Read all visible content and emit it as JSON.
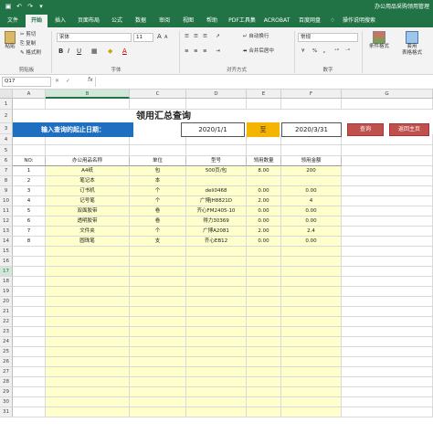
{
  "title": {
    "doc": "办公用品采购领用管理"
  },
  "qat": {
    "save_icon": "save-icon",
    "undo_icon": "undo-icon",
    "redo_icon": "redo-icon",
    "customize_icon": "customize-icon"
  },
  "tabs": [
    "文件",
    "开始",
    "插入",
    "页面布局",
    "公式",
    "数据",
    "审阅",
    "视图",
    "帮助",
    "PDF工具集",
    "ACROBAT",
    "百度网盘",
    "操作说明搜索"
  ],
  "active_tab": "开始",
  "ribbon": {
    "paste": "粘贴",
    "cut": "剪切",
    "copy": "复制",
    "format_painter": "格式刷",
    "clipboard": "剪贴板",
    "font_name": "宋体",
    "font_size": "11",
    "font_group": "字体",
    "wrap_text": "自动换行",
    "merge_center": "合并后居中",
    "align_group": "对齐方式",
    "number_format": "常规",
    "number_group": "数字",
    "cond_format": "条件格式",
    "table_format": "套用\n表格格式",
    "bold": "B",
    "italic": "I",
    "underline": "U",
    "font_grow": "A",
    "font_shrink": "A",
    "font_color": "A",
    "percent": "%",
    "comma": ","
  },
  "formula_bar": {
    "name_box": "Q17",
    "fx": "fx",
    "value": ""
  },
  "columns": [
    "A",
    "B",
    "C",
    "D",
    "E",
    "F",
    "G"
  ],
  "rows": [
    "1",
    "2",
    "3",
    "4",
    "5",
    "6",
    "7",
    "8",
    "9",
    "10",
    "11",
    "12",
    "13",
    "14",
    "15",
    "16",
    "17",
    "18",
    "19",
    "20",
    "21",
    "22",
    "23",
    "24",
    "25",
    "26",
    "27",
    "28",
    "29",
    "30",
    "31"
  ],
  "sheet": {
    "title": "领用汇总查询",
    "query_label": "输入查询的起止日期：",
    "start_date": "2020/1/1",
    "to_label": "至",
    "end_date": "2020/3/31",
    "query_button": "查询",
    "home_button": "返回主页"
  },
  "table": {
    "headers": [
      "NO:",
      "办公用品名称",
      "单位",
      "型号",
      "领用数量",
      "领用金额"
    ],
    "rows": [
      [
        "1",
        "A4纸",
        "包",
        "500页/包",
        "8.00",
        "200"
      ],
      [
        "2",
        "笔记本",
        "本",
        "",
        "",
        ""
      ],
      [
        "3",
        "订书机",
        "个",
        "deli0468",
        "0.00",
        "0.00"
      ],
      [
        "4",
        "记号笔",
        "个",
        "广博JH8821D",
        "2.00",
        "4"
      ],
      [
        "5",
        "双面胶带",
        "卷",
        "齐心FM2405-10",
        "0.00",
        "0.00"
      ],
      [
        "6",
        "透明胶带",
        "卷",
        "得力30369",
        "0.00",
        "0.00"
      ],
      [
        "7",
        "文件夹",
        "个",
        "广博A2081",
        "2.00",
        "2.4"
      ],
      [
        "8",
        "圆珠笔",
        "支",
        "齐心EB12",
        "0.00",
        "0.00"
      ]
    ]
  },
  "colors": {
    "excel_green": "#217346",
    "query_blue": "#1f6fc0",
    "to_orange": "#f4b400",
    "button_red": "#c0504d",
    "cell_yellow": "#ffffcc"
  }
}
